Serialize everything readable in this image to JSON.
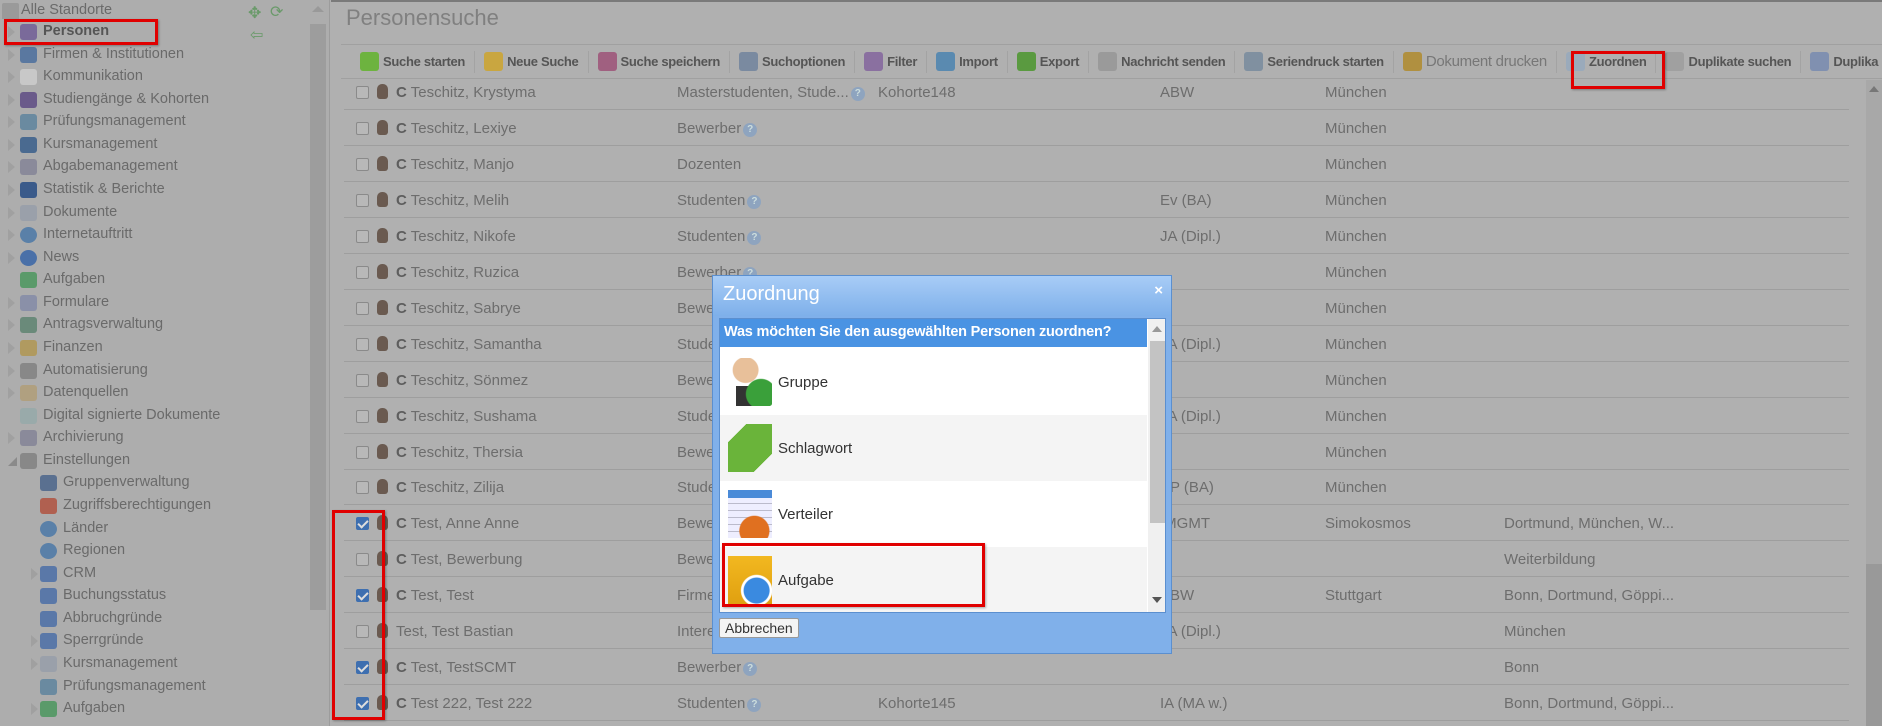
{
  "sidebar": {
    "root": "Alle Standorte",
    "items": [
      {
        "label": "Personen",
        "level": 1,
        "toggle": "closed",
        "icon": "persons-icon",
        "bold": true
      },
      {
        "label": "Firmen & Institutionen",
        "level": 1,
        "toggle": "closed",
        "icon": "factory-icon"
      },
      {
        "label": "Kommunikation",
        "level": 1,
        "toggle": "closed",
        "icon": "envelope-icon"
      },
      {
        "label": "Studiengänge & Kohorten",
        "level": 1,
        "toggle": "closed",
        "icon": "graduation-icon"
      },
      {
        "label": "Prüfungsmanagement",
        "level": 1,
        "toggle": "closed",
        "icon": "exam-icon"
      },
      {
        "label": "Kursmanagement",
        "level": 1,
        "toggle": "closed",
        "icon": "book-icon"
      },
      {
        "label": "Abgabemanagement",
        "level": 1,
        "toggle": "closed",
        "icon": "id-card-icon"
      },
      {
        "label": "Statistik & Berichte",
        "level": 1,
        "toggle": "closed",
        "icon": "bar-chart-icon"
      },
      {
        "label": "Dokumente",
        "level": 1,
        "toggle": "closed",
        "icon": "folder-icon"
      },
      {
        "label": "Internetauftritt",
        "level": 1,
        "toggle": "closed",
        "icon": "globe-icon"
      },
      {
        "label": "News",
        "level": 1,
        "toggle": "closed",
        "icon": "info-icon"
      },
      {
        "label": "Aufgaben",
        "level": 1,
        "toggle": "none",
        "icon": "clock-arrow-icon"
      },
      {
        "label": "Formulare",
        "level": 1,
        "toggle": "closed",
        "icon": "form-icon"
      },
      {
        "label": "Antragsverwaltung",
        "level": 1,
        "toggle": "closed",
        "icon": "application-icon"
      },
      {
        "label": "Finanzen",
        "level": 1,
        "toggle": "closed",
        "icon": "coins-icon"
      },
      {
        "label": "Automatisierung",
        "level": 1,
        "toggle": "closed",
        "icon": "gear-icon"
      },
      {
        "label": "Datenquellen",
        "level": 1,
        "toggle": "closed",
        "icon": "database-icon"
      },
      {
        "label": "Digital signierte Dokumente",
        "level": 1,
        "toggle": "none",
        "icon": "certificate-icon"
      },
      {
        "label": "Archivierung",
        "level": 1,
        "toggle": "closed",
        "icon": "id-card-icon"
      },
      {
        "label": "Einstellungen",
        "level": 1,
        "toggle": "open",
        "icon": "gear-icon"
      },
      {
        "label": "Gruppenverwaltung",
        "level": 2,
        "toggle": "none",
        "icon": "user-group-icon"
      },
      {
        "label": "Zugriffsberechtigungen",
        "level": 2,
        "toggle": "none",
        "icon": "shield-icon"
      },
      {
        "label": "Länder",
        "level": 2,
        "toggle": "none",
        "icon": "globe-icon"
      },
      {
        "label": "Regionen",
        "level": 2,
        "toggle": "none",
        "icon": "globe-icon"
      },
      {
        "label": "CRM",
        "level": 2,
        "toggle": "closed",
        "icon": "tag-icon"
      },
      {
        "label": "Buchungsstatus",
        "level": 2,
        "toggle": "none",
        "icon": "tag-icon"
      },
      {
        "label": "Abbruchgründe",
        "level": 2,
        "toggle": "none",
        "icon": "tag-icon"
      },
      {
        "label": "Sperrgründe",
        "level": 2,
        "toggle": "closed",
        "icon": "tag-icon"
      },
      {
        "label": "Kursmanagement",
        "level": 2,
        "toggle": "closed",
        "icon": "folder-icon"
      },
      {
        "label": "Prüfungsmanagement",
        "level": 2,
        "toggle": "none",
        "icon": "exam-icon"
      },
      {
        "label": "Aufgaben",
        "level": 2,
        "toggle": "closed",
        "icon": "clock-arrow-icon"
      }
    ]
  },
  "header": {
    "title": "Personensuche"
  },
  "toolbar": [
    {
      "label": "Suche starten",
      "icon": "search-icon",
      "color": "#6db33f"
    },
    {
      "label": "Neue Suche",
      "icon": "new-search-icon",
      "color": "#c9a640"
    },
    {
      "label": "Suche speichern",
      "icon": "save-search-icon",
      "color": "#a06080"
    },
    {
      "label": "Suchoptionen",
      "icon": "search-options-icon",
      "color": "#7a8aa0"
    },
    {
      "label": "Filter",
      "icon": "filter-icon",
      "color": "#8a70a0"
    },
    {
      "label": "Import",
      "icon": "import-icon",
      "color": "#5a8ab0"
    },
    {
      "label": "Export",
      "icon": "export-icon",
      "color": "#5a9a40"
    },
    {
      "label": "Nachricht senden",
      "icon": "message-icon",
      "color": "#9a9a9a"
    },
    {
      "label": "Seriendruck starten",
      "icon": "mail-merge-icon",
      "color": "#8090a0"
    },
    {
      "label": "Dokument drucken",
      "icon": "print-document-icon",
      "color": "#b09040",
      "plain": true
    },
    {
      "label": "Zuordnen",
      "icon": "assign-hand-icon",
      "color": "#9aaabb"
    },
    {
      "label": "Duplikate suchen",
      "icon": "duplicates-icon",
      "color": "#a0a0a0"
    },
    {
      "label": "Duplika",
      "icon": "duplicates-icon",
      "color": "#8090b0"
    }
  ],
  "rows": [
    {
      "checked": false,
      "c": "C",
      "name": "Teschitz, Krystyma",
      "group": "Masterstudenten, Stude...",
      "info": true,
      "kohorte": "Kohorte148",
      "col4": "ABW",
      "col5": "München",
      "col6": ""
    },
    {
      "checked": false,
      "c": "C",
      "name": "Teschitz, Lexiye",
      "group": "Bewerber",
      "info": true,
      "kohorte": "",
      "col4": "",
      "col5": "München",
      "col6": ""
    },
    {
      "checked": false,
      "c": "C",
      "name": "Teschitz, Manjo",
      "group": "Dozenten",
      "info": false,
      "kohorte": "",
      "col4": "",
      "col5": "München",
      "col6": ""
    },
    {
      "checked": false,
      "c": "C",
      "name": "Teschitz, Melih",
      "group": "Studenten",
      "info": true,
      "kohorte": "",
      "col4": "Ev (BA)",
      "col5": "München",
      "col6": ""
    },
    {
      "checked": false,
      "c": "C",
      "name": "Teschitz, Nikofe",
      "group": "Studenten",
      "info": true,
      "kohorte": "",
      "col4": "JA (Dipl.)",
      "col5": "München",
      "col6": ""
    },
    {
      "checked": false,
      "c": "C",
      "name": "Teschitz, Ruzica",
      "group": "Bewerber",
      "info": true,
      "kohorte": "",
      "col4": "",
      "col5": "München",
      "col6": ""
    },
    {
      "checked": false,
      "c": "C",
      "name": "Teschitz, Sabrye",
      "group": "Bewerber",
      "info": true,
      "kohorte": "",
      "col4": "",
      "col5": "München",
      "col6": ""
    },
    {
      "checked": false,
      "c": "C",
      "name": "Teschitz, Samantha",
      "group": "Studenten",
      "info": true,
      "kohorte": "",
      "col4": "JA (Dipl.)",
      "col5": "München",
      "col6": ""
    },
    {
      "checked": false,
      "c": "C",
      "name": "Teschitz, Sönmez",
      "group": "Bewerber",
      "info": true,
      "kohorte": "",
      "col4": "",
      "col5": "München",
      "col6": ""
    },
    {
      "checked": false,
      "c": "C",
      "name": "Teschitz, Sushama",
      "group": "Studenten",
      "info": true,
      "kohorte": "",
      "col4": "JA (Dipl.)",
      "col5": "München",
      "col6": ""
    },
    {
      "checked": false,
      "c": "C",
      "name": "Teschitz, Thersia",
      "group": "Bewerber",
      "info": true,
      "kohorte": "",
      "col4": "",
      "col5": "München",
      "col6": ""
    },
    {
      "checked": false,
      "c": "C",
      "name": "Teschitz, Zilija",
      "group": "Studenten",
      "info": true,
      "kohorte": "",
      "col4": "BP (BA)",
      "col5": "München",
      "col6": ""
    },
    {
      "checked": true,
      "c": "C",
      "name": "Test, Anne Anne",
      "group": "Bewerber",
      "info": true,
      "kohorte": "",
      "col4": "IMGMT",
      "col5": "Simokosmos",
      "col6": "Dortmund, München, W..."
    },
    {
      "checked": false,
      "c": "C",
      "name": "Test, Bewerbung",
      "group": "Bewerber",
      "info": true,
      "kohorte": "",
      "col4": "",
      "col5": "",
      "col6": "Weiterbildung"
    },
    {
      "checked": true,
      "c": "C",
      "name": "Test, Test",
      "group": "Firmen",
      "info": false,
      "kohorte": "",
      "col4": "ABW",
      "col5": "Stuttgart",
      "col6": "Bonn, Dortmund, Göppi..."
    },
    {
      "checked": false,
      "c": "",
      "name": "Test, Test Bastian",
      "group": "Interessenten",
      "info": false,
      "kohorte": "",
      "col4": "JA (Dipl.)",
      "col5": "",
      "col6": "München"
    },
    {
      "checked": true,
      "c": "C",
      "name": "Test, TestSCMT",
      "group": "Bewerber",
      "info": true,
      "kohorte": "",
      "col4": "",
      "col5": "",
      "col6": "Bonn"
    },
    {
      "checked": true,
      "c": "C",
      "name": "Test 222, Test 222",
      "group": "Studenten",
      "info": true,
      "kohorte": "Kohorte145",
      "col4": "IA (MA w.)",
      "col5": "",
      "col6": "Bonn, Dortmund, Göppi..."
    }
  ],
  "dialog": {
    "title": "Zuordnung",
    "close": "×",
    "question": "Was möchten Sie den ausgewählten Personen zuordnen?",
    "options": [
      {
        "label": "Gruppe",
        "icon": "user-add-icon"
      },
      {
        "label": "Schlagwort",
        "icon": "green-tag-icon"
      },
      {
        "label": "Verteiler",
        "icon": "distribution-list-icon"
      },
      {
        "label": "Aufgabe",
        "icon": "folder-clock-icon"
      }
    ],
    "cancel": "Abbrechen"
  },
  "colors": {
    "highlight": "#e00000",
    "dialog": "#80b0ea",
    "dialog_header": "#4a93e3"
  }
}
